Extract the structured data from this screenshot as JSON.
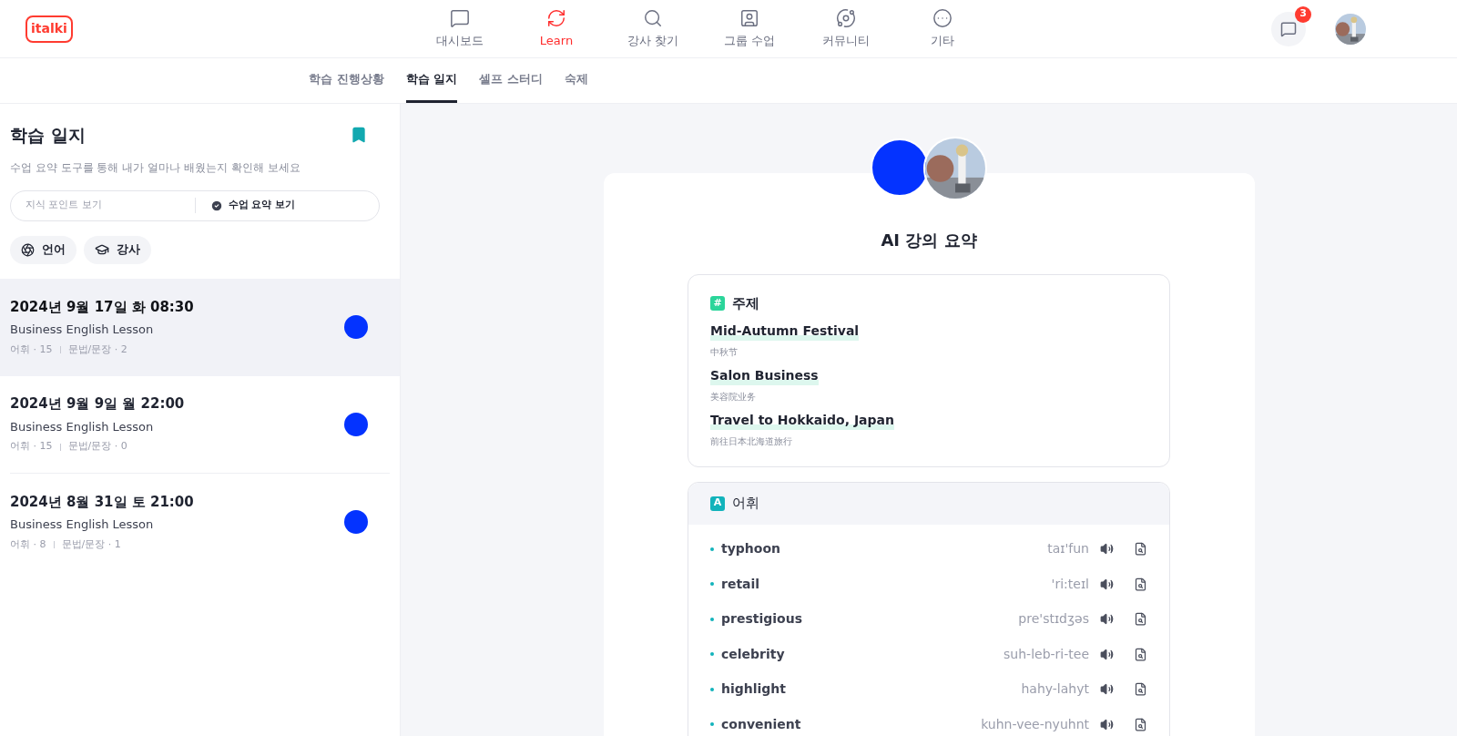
{
  "logo": "italki",
  "nav": [
    {
      "label": "대시보드",
      "selected": false
    },
    {
      "label": "Learn",
      "selected": true
    },
    {
      "label": "강사 찾기",
      "selected": false
    },
    {
      "label": "그룹 수업",
      "selected": false
    },
    {
      "label": "커뮤니티",
      "selected": false
    },
    {
      "label": "기타",
      "selected": false
    }
  ],
  "messages": {
    "badge": "3"
  },
  "subtabs": [
    {
      "label": "학습 진행상황",
      "selected": false
    },
    {
      "label": "학습 일지",
      "selected": true
    },
    {
      "label": "셀프 스터디",
      "selected": false
    },
    {
      "label": "숙제",
      "selected": false
    }
  ],
  "sidebar": {
    "title": "학습 일지",
    "subtitle": "수업 요약 도구를 통해 내가 얼마나 배웠는지 확인해 보세요",
    "toggle": [
      {
        "label": "지식 포인트 보기",
        "selected": false
      },
      {
        "label": "수업 요약 보기",
        "selected": true
      }
    ],
    "filters": [
      "언어",
      "강사"
    ],
    "lessons": [
      {
        "date": "2024년 9월 17일 화 08:30",
        "title": "Business English Lesson",
        "vocab": "어휘 · 15",
        "grammar": "문법/문장 · 2",
        "selected": true
      },
      {
        "date": "2024년 9월 9일 월 22:00",
        "title": "Business English Lesson",
        "vocab": "어휘 · 15",
        "grammar": "문법/문장 · 0",
        "selected": false
      },
      {
        "date": "2024년 8월 31일 토 21:00",
        "title": "Business English Lesson",
        "vocab": "어휘 · 8",
        "grammar": "문법/문장 · 1",
        "selected": false
      }
    ]
  },
  "summary": {
    "title": "AI 강의 요약",
    "topics": {
      "badge": "#",
      "heading": "주제",
      "items": [
        {
          "name": "Mid-Autumn Festival",
          "translation": "中秋节"
        },
        {
          "name": "Salon Business",
          "translation": "美容院业务"
        },
        {
          "name": "Travel to Hokkaido, Japan",
          "translation": "前往日本北海道旅行"
        }
      ]
    },
    "vocabulary": {
      "badge": "A",
      "heading": "어휘",
      "items": [
        {
          "word": "typhoon",
          "pronunciation": "taɪ'fun"
        },
        {
          "word": "retail",
          "pronunciation": "'ri:teɪl"
        },
        {
          "word": "prestigious",
          "pronunciation": "pre'stɪdʒəs"
        },
        {
          "word": "celebrity",
          "pronunciation": "suh-leb-ri-tee"
        },
        {
          "word": "highlight",
          "pronunciation": "hahy-lahyt"
        },
        {
          "word": "convenient",
          "pronunciation": "kuhn-vee-nyuhnt"
        }
      ]
    }
  }
}
